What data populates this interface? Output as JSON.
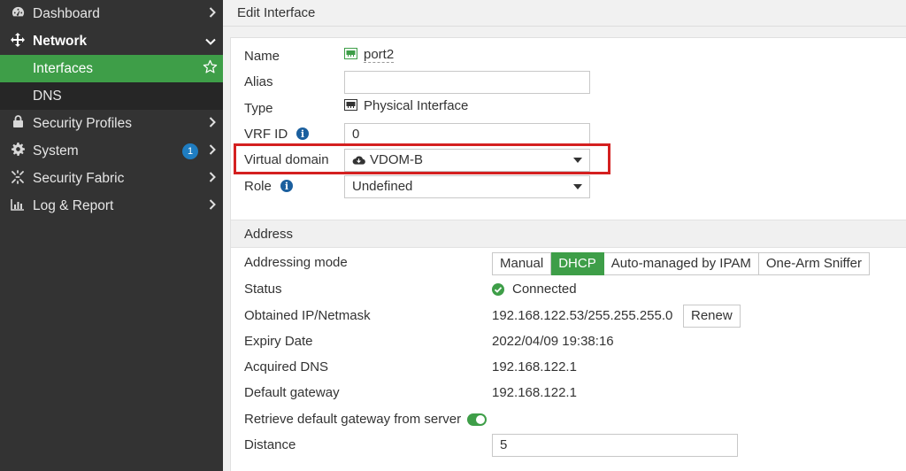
{
  "sidebar": {
    "items": [
      {
        "label": "Dashboard",
        "icon": "dashboard-icon"
      },
      {
        "label": "Network",
        "icon": "network-icon"
      },
      {
        "label": "Interfaces"
      },
      {
        "label": "DNS"
      },
      {
        "label": "Security Profiles",
        "icon": "lock-icon"
      },
      {
        "label": "System",
        "icon": "gear-icon",
        "badge": "1"
      },
      {
        "label": "Security Fabric",
        "icon": "fabric-icon"
      },
      {
        "label": "Log & Report",
        "icon": "chart-icon"
      }
    ]
  },
  "header": {
    "title": "Edit Interface"
  },
  "form": {
    "name_label": "Name",
    "name_value": "port2",
    "alias_label": "Alias",
    "alias_value": "",
    "type_label": "Type",
    "type_value": "Physical Interface",
    "vrf_label": "VRF ID",
    "vrf_value": "0",
    "vdom_label": "Virtual domain",
    "vdom_value": "VDOM-B",
    "role_label": "Role",
    "role_value": "Undefined"
  },
  "address": {
    "section_title": "Address",
    "mode_label": "Addressing mode",
    "modes": [
      "Manual",
      "DHCP",
      "Auto-managed by IPAM",
      "One-Arm Sniffer"
    ],
    "selected_mode": "DHCP",
    "status_label": "Status",
    "status_value": "Connected",
    "ip_label": "Obtained IP/Netmask",
    "ip_value": "192.168.122.53/255.255.255.0",
    "renew_label": "Renew",
    "expiry_label": "Expiry Date",
    "expiry_value": "2022/04/09 19:38:16",
    "dns_label": "Acquired DNS",
    "dns_value": "192.168.122.1",
    "gateway_label": "Default gateway",
    "gateway_value": "192.168.122.1",
    "retrieve_label": "Retrieve default gateway from server",
    "retrieve_enabled": true,
    "distance_label": "Distance",
    "distance_value": "5"
  },
  "colors": {
    "sidebar_bg": "#333333",
    "accent_green": "#3e9e48",
    "highlight_red": "#d42020",
    "badge_blue": "#1f7dc1"
  }
}
